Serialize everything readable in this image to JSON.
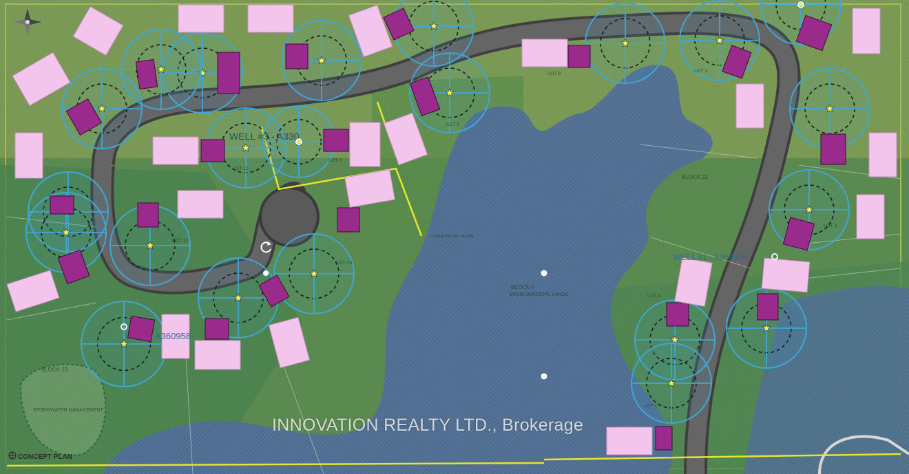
{
  "watermark": "INNOVATION REALTY LTD., Brokerage",
  "title_block": {
    "label": "CONCEPT PLAN"
  },
  "wells": [
    {
      "label": "WELL #3 - A330"
    },
    {
      "label": "WELL #1 - A360958"
    },
    {
      "label": "A360958"
    }
  ],
  "lots": [
    {
      "label": "LOT 8"
    },
    {
      "label": "LOT 9"
    },
    {
      "label": "LOT 11"
    },
    {
      "label": "LOT 12"
    },
    {
      "label": "LOT 13"
    },
    {
      "label": "LOT 5"
    },
    {
      "label": "LOT 4"
    },
    {
      "label": "LOT 3"
    },
    {
      "label": "LOT 2"
    },
    {
      "label": "LOT 1"
    }
  ],
  "blocks": [
    {
      "label": "BLOCK F"
    },
    {
      "label": "BLOCK 22"
    },
    {
      "label": "BLOCK 23"
    }
  ],
  "annotations": [
    {
      "label": "STORMWATER MANAGEMENT"
    },
    {
      "label": "FUNDERBURK DRAIN"
    },
    {
      "label": "ENVIRONMENTAL LANDS"
    }
  ],
  "colors": {
    "water": "#5d6fb3",
    "vegetation": "#6d9460",
    "road": "#5b5b5b",
    "house": "#9b2a8d",
    "placeholder": "#f3c5ec",
    "circle": "#3fa6d6",
    "lot_line": "#e6e62f"
  }
}
